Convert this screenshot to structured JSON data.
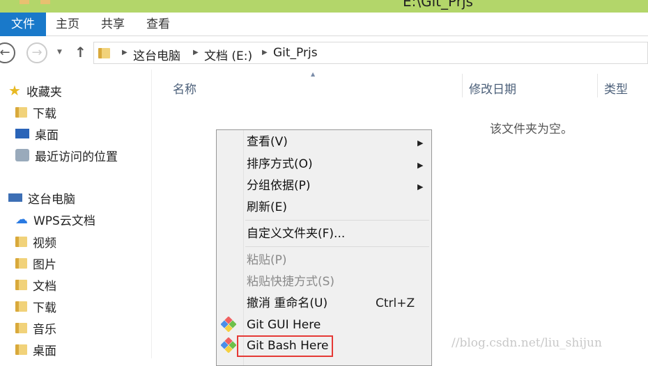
{
  "window": {
    "title": "E:\\Git_Prjs"
  },
  "ribbon": {
    "tabs": [
      "文件",
      "主页",
      "共享",
      "查看"
    ]
  },
  "address": {
    "crumbs": [
      "这台电脑",
      "文档 (E:)",
      "Git_Prjs"
    ]
  },
  "sidebar": {
    "favorites": {
      "label": "收藏夹",
      "items": [
        "下载",
        "桌面",
        "最近访问的位置"
      ]
    },
    "computer": {
      "label": "这台电脑",
      "items": [
        "WPS云文档",
        "视频",
        "图片",
        "文档",
        "下载",
        "音乐",
        "桌面"
      ]
    }
  },
  "columns": [
    "名称",
    "修改日期",
    "类型"
  ],
  "empty_text": "该文件夹为空。",
  "menu": {
    "items": [
      "查看(V)",
      "排序方式(O)",
      "分组依据(P)",
      "刷新(E)",
      "自定义文件夹(F)...",
      "粘贴(P)",
      "粘贴快捷方式(S)",
      "撤消 重命名(U)",
      "Git GUI Here",
      "Git Bash Here"
    ],
    "undo_shortcut": "Ctrl+Z"
  },
  "watermark": "//blog.csdn.net/liu_shijun",
  "colors": {
    "titlebar": "#b3d66a",
    "file_tab": "#1979ca",
    "highlight": "#e53935"
  }
}
